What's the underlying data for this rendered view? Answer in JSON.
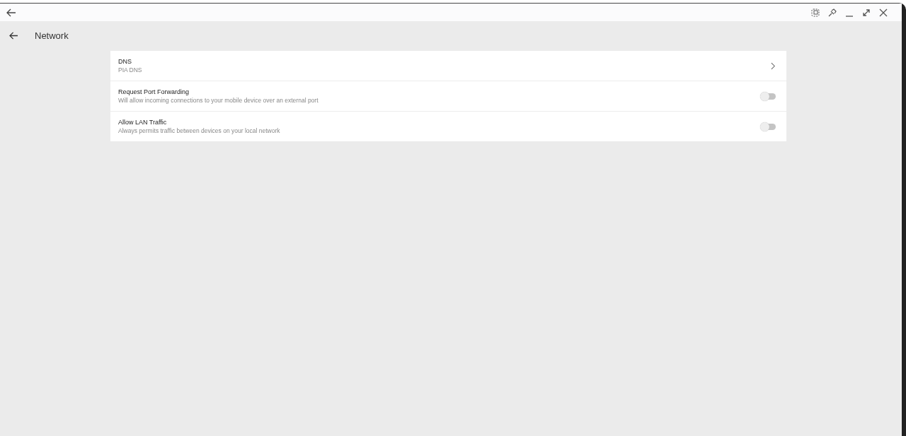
{
  "page": {
    "title": "Network"
  },
  "rows": [
    {
      "kind": "nav",
      "title": "DNS",
      "subtitle": "PIA DNS"
    },
    {
      "kind": "toggle",
      "title": "Request Port Forwarding",
      "subtitle": "Will allow incoming connections to your mobile device over an external port",
      "on": false
    },
    {
      "kind": "toggle",
      "title": "Allow LAN Traffic",
      "subtitle": "Always permits traffic between devices on your local network",
      "on": false
    }
  ]
}
